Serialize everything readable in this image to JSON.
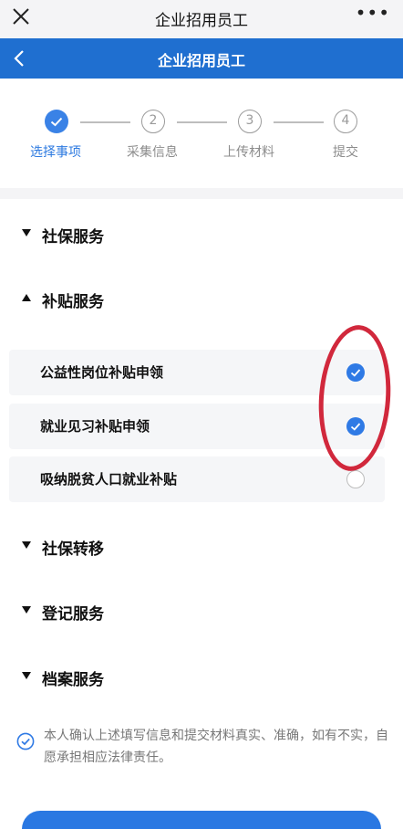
{
  "top_bar": {
    "title": "企业招用员工",
    "close_icon": "close-icon",
    "more_icon": "more-icon",
    "more_glyph": "•••"
  },
  "nav_bar": {
    "title": "企业招用员工",
    "back_icon": "chevron-left-icon"
  },
  "steps": [
    {
      "number": "1",
      "label": "选择事项",
      "state": "done"
    },
    {
      "number": "2",
      "label": "采集信息",
      "state": "todo"
    },
    {
      "number": "3",
      "label": "上传材料",
      "state": "todo"
    },
    {
      "number": "4",
      "label": "提交",
      "state": "todo"
    }
  ],
  "sections": [
    {
      "label": "社保服务",
      "expanded": false
    },
    {
      "label": "补贴服务",
      "expanded": true
    },
    {
      "label": "社保转移",
      "expanded": false
    },
    {
      "label": "登记服务",
      "expanded": false
    },
    {
      "label": "档案服务",
      "expanded": false
    }
  ],
  "subsidy_items": [
    {
      "label": "公益性岗位补贴申领",
      "checked": true
    },
    {
      "label": "就业见习补贴申领",
      "checked": true
    },
    {
      "label": "吸纳脱贫人口就业补贴",
      "checked": false
    }
  ],
  "agreement": {
    "text": "本人确认上述填写信息和提交材料真实、准确，如有不实，自愿承担相应法律责任。",
    "checked": true
  },
  "colors": {
    "accent": "#1f6fd0",
    "check": "#2f7ae5",
    "highlight": "#d1283c"
  }
}
